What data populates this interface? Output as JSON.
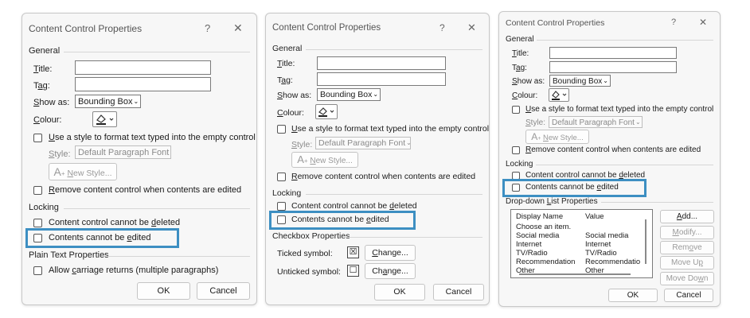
{
  "dialogs": {
    "plain_text": {
      "title": "Content Control Properties",
      "help": "?",
      "close": "✕",
      "general": "General",
      "title_label": "Title:",
      "tag_label": "Tag:",
      "show_as_label": "Show as:",
      "show_as_value": "Bounding Box",
      "colour_label": "Colour:",
      "use_style": "Use a style to format text typed into the empty control",
      "style_label": "Style:",
      "style_value": "Default Paragraph Font",
      "new_style": "New Style...",
      "remove_when_edited": "Remove content control when contents are edited",
      "locking": "Locking",
      "cannot_delete": "Content control cannot be deleted",
      "cannot_edit": "Contents cannot be edited",
      "plain_text_props": "Plain Text Properties",
      "allow_returns": "Allow carriage returns (multiple paragraphs)",
      "ok": "OK",
      "cancel": "Cancel"
    },
    "checkbox": {
      "title": "Content Control Properties",
      "help": "?",
      "close": "✕",
      "general": "General",
      "title_label": "Title:",
      "tag_label": "Tag:",
      "show_as_label": "Show as:",
      "show_as_value": "Bounding Box",
      "colour_label": "Colour:",
      "use_style": "Use a style to format text typed into the empty control",
      "style_label": "Style:",
      "style_value": "Default Paragraph Font",
      "new_style": "New Style...",
      "remove_when_edited": "Remove content control when contents are edited",
      "locking": "Locking",
      "cannot_delete": "Content control cannot be deleted",
      "cannot_edit": "Contents cannot be edited",
      "checkbox_props": "Checkbox Properties",
      "ticked_label": "Ticked symbol:",
      "ticked_symbol": "☒",
      "unticked_label": "Unticked symbol:",
      "unticked_symbol": "☐",
      "change": "Change...",
      "ok": "OK",
      "cancel": "Cancel"
    },
    "dropdown": {
      "title": "Content Control Properties",
      "help": "?",
      "close": "✕",
      "general": "General",
      "title_label": "Title:",
      "tag_label": "Tag:",
      "show_as_label": "Show as:",
      "show_as_value": "Bounding Box",
      "colour_label": "Colour:",
      "use_style": "Use a style to format text typed into the empty control",
      "style_label": "Style:",
      "style_value": "Default Paragraph Font",
      "new_style": "New Style...",
      "remove_when_edited": "Remove content control when contents are edited",
      "locking": "Locking",
      "cannot_delete": "Content control cannot be deleted",
      "cannot_edit": "Contents cannot be edited",
      "dropdown_props": "Drop-down List Properties",
      "col_display": "Display Name",
      "col_value": "Value",
      "rows": [
        {
          "display": "Choose an item.",
          "value": ""
        },
        {
          "display": "Social media",
          "value": "Social media"
        },
        {
          "display": "Internet",
          "value": "Internet"
        },
        {
          "display": "TV/Radio",
          "value": "TV/Radio"
        },
        {
          "display": "Recommendation",
          "value": "Recommendatio"
        },
        {
          "display": "Other",
          "value": "Other"
        }
      ],
      "add": "Add...",
      "modify": "Modify...",
      "remove": "Remove",
      "move_up": "Move Up",
      "move_down": "Move Down",
      "ok": "OK",
      "cancel": "Cancel"
    }
  }
}
